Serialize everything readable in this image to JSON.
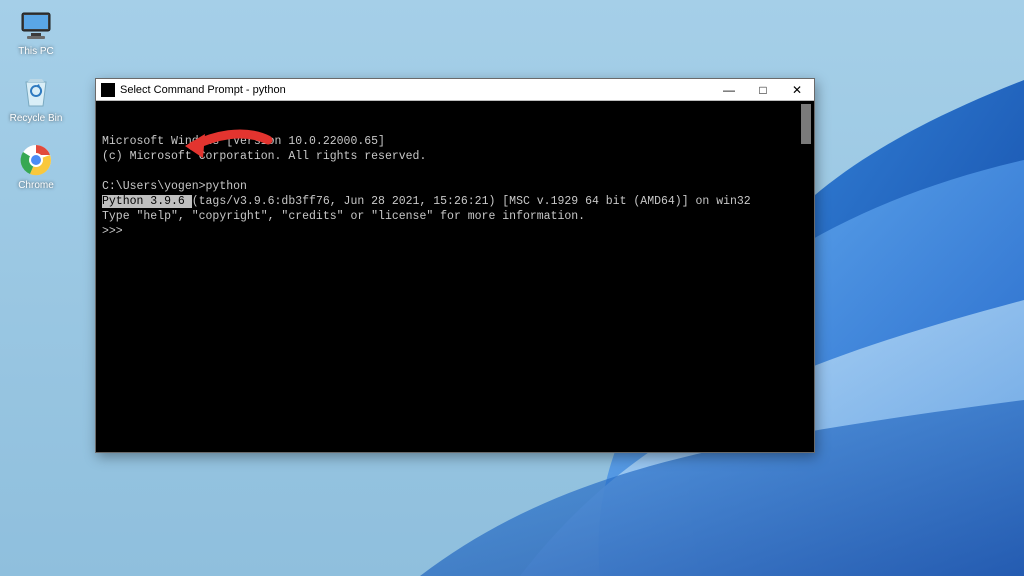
{
  "desktop": {
    "icons": {
      "this_pc": "This PC",
      "recycle_bin": "Recycle Bin",
      "chrome": "Chrome"
    }
  },
  "window": {
    "title": "Select Command Prompt - python",
    "buttons": {
      "minimize": "—",
      "maximize": "□",
      "close": "✕"
    }
  },
  "terminal": {
    "line1": "Microsoft Windows [Version 10.0.22000.65]",
    "line2": "(c) Microsoft Corporation. All rights reserved.",
    "blank": "",
    "prompt_path": "C:\\Users\\yogen>",
    "prompt_cmd": "python",
    "py_ver_hl": "Python 3.9.6 ",
    "py_ver_rest": "(tags/v3.9.6:db3ff76, Jun 28 2021, 15:26:21) [MSC v.1929 64 bit (AMD64)] on win32",
    "py_help": "Type \"help\", \"copyright\", \"credits\" or \"license\" for more information.",
    "repl": ">>>"
  }
}
